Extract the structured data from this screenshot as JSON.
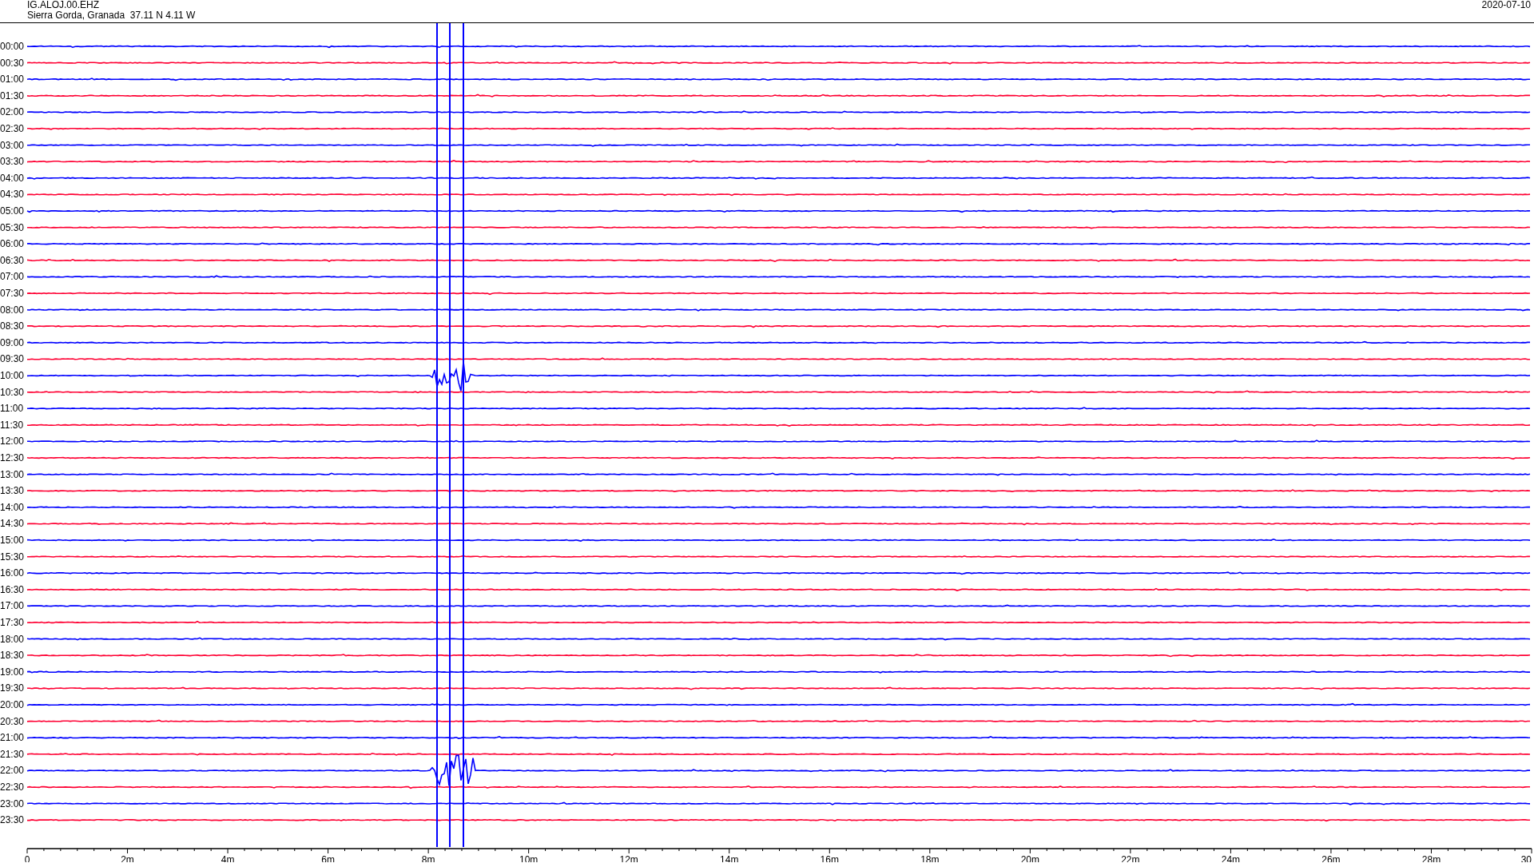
{
  "header": {
    "station": "IG.ALOJ.00.EHZ",
    "location": "Sierra Gorda, Granada  37.11 N 4.11 W",
    "date": "2020-07-10"
  },
  "traces": [
    {
      "time": "00:00",
      "color": "#0000ff"
    },
    {
      "time": "00:30",
      "color": "#ff0033"
    },
    {
      "time": "01:00",
      "color": "#0000ff"
    },
    {
      "time": "01:30",
      "color": "#ff0033"
    },
    {
      "time": "02:00",
      "color": "#0000ff"
    },
    {
      "time": "02:30",
      "color": "#ff0033"
    },
    {
      "time": "03:00",
      "color": "#0000ff"
    },
    {
      "time": "03:30",
      "color": "#ff0033"
    },
    {
      "time": "04:00",
      "color": "#0000ff"
    },
    {
      "time": "04:30",
      "color": "#ff0033"
    },
    {
      "time": "05:00",
      "color": "#0000ff"
    },
    {
      "time": "05:30",
      "color": "#ff0033"
    },
    {
      "time": "06:00",
      "color": "#0000ff"
    },
    {
      "time": "06:30",
      "color": "#ff0033"
    },
    {
      "time": "07:00",
      "color": "#0000ff"
    },
    {
      "time": "07:30",
      "color": "#ff0033"
    },
    {
      "time": "08:00",
      "color": "#0000ff"
    },
    {
      "time": "08:30",
      "color": "#ff0033"
    },
    {
      "time": "09:00",
      "color": "#0000ff"
    },
    {
      "time": "09:30",
      "color": "#ff0033"
    },
    {
      "time": "10:00",
      "color": "#0000ff"
    },
    {
      "time": "10:30",
      "color": "#ff0033"
    },
    {
      "time": "11:00",
      "color": "#0000ff"
    },
    {
      "time": "11:30",
      "color": "#ff0033"
    },
    {
      "time": "12:00",
      "color": "#0000ff"
    },
    {
      "time": "12:30",
      "color": "#ff0033"
    },
    {
      "time": "13:00",
      "color": "#0000ff"
    },
    {
      "time": "13:30",
      "color": "#ff0033"
    },
    {
      "time": "14:00",
      "color": "#0000ff"
    },
    {
      "time": "14:30",
      "color": "#ff0033"
    },
    {
      "time": "15:00",
      "color": "#0000ff"
    },
    {
      "time": "15:30",
      "color": "#ff0033"
    },
    {
      "time": "16:00",
      "color": "#0000ff"
    },
    {
      "time": "16:30",
      "color": "#ff0033"
    },
    {
      "time": "17:00",
      "color": "#0000ff"
    },
    {
      "time": "17:30",
      "color": "#ff0033"
    },
    {
      "time": "18:00",
      "color": "#0000ff"
    },
    {
      "time": "18:30",
      "color": "#ff0033"
    },
    {
      "time": "19:00",
      "color": "#0000ff"
    },
    {
      "time": "19:30",
      "color": "#ff0033"
    },
    {
      "time": "20:00",
      "color": "#0000ff"
    },
    {
      "time": "20:30",
      "color": "#ff0033"
    },
    {
      "time": "21:00",
      "color": "#0000ff"
    },
    {
      "time": "21:30",
      "color": "#ff0033"
    },
    {
      "time": "22:00",
      "color": "#0000ff"
    },
    {
      "time": "22:30",
      "color": "#ff0033"
    },
    {
      "time": "23:00",
      "color": "#0000ff"
    },
    {
      "time": "23:30",
      "color": "#ff0033"
    }
  ],
  "axis": {
    "labels": [
      "0",
      "2m",
      "4m",
      "6m",
      "8m",
      "10m",
      "12m",
      "14m",
      "16m",
      "18m",
      "20m",
      "22m",
      "24m",
      "26m",
      "28m",
      "30"
    ]
  }
}
